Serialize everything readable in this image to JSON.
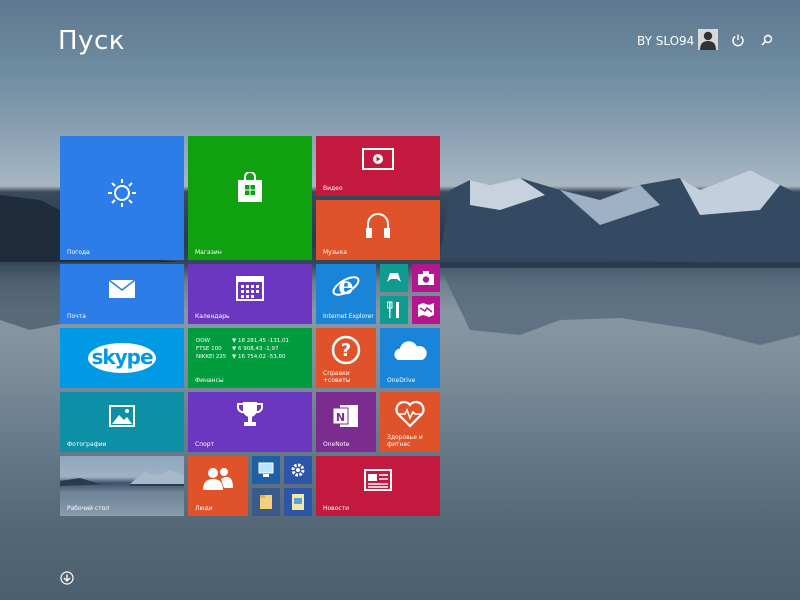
{
  "header": {
    "title": "Пуск",
    "user_name": "BY SLO94"
  },
  "tiles": {
    "weather": "Погода",
    "store": "Магазин",
    "video": "Видео",
    "music": "Музыка",
    "mail": "Почта",
    "calendar": "Календарь",
    "ie": "Internet Explorer",
    "skype": "skype",
    "finance": "Финансы",
    "help": "Справки +советы",
    "onedrive": "OneDrive",
    "photos": "Фотографии",
    "sport": "Спорт",
    "onenote": "OneNote",
    "health": "Здоровье и фитнес",
    "desktop": "Рабочий стол",
    "people": "Люди",
    "news": "Новости"
  },
  "finance_quotes": [
    {
      "name": "DOW",
      "value": "▼ 18 281,45 -131,01"
    },
    {
      "name": "FTSE 100",
      "value": "▼ 6 908,43 -1,97"
    },
    {
      "name": "NIKKEI 225",
      "value": "▼ 16 754,02 -53,60"
    }
  ],
  "colors": {
    "blue": "#2d7de8",
    "green": "#0fa10f",
    "crimson": "#c3193f",
    "orange": "#e0522a",
    "purple": "#6b37c0",
    "teal": "#0d8fa5",
    "skype": "#009ae4",
    "finance": "#009c3d",
    "onenote": "#7a2c8f",
    "magenta": "#b3168f"
  },
  "icons": [
    "weather-icon",
    "store-icon",
    "video-icon",
    "music-icon",
    "mail-icon",
    "calendar-icon",
    "ie-icon",
    "xbox-games-icon",
    "camera-icon",
    "food-icon",
    "maps-icon",
    "help-icon",
    "onedrive-icon",
    "photos-icon",
    "trophy-icon",
    "onenote-icon",
    "health-icon",
    "people-icon",
    "computer-icon",
    "settings-icon",
    "file-explorer-icon",
    "document-icon",
    "news-icon",
    "power-icon",
    "search-icon",
    "arrow-down-icon"
  ]
}
